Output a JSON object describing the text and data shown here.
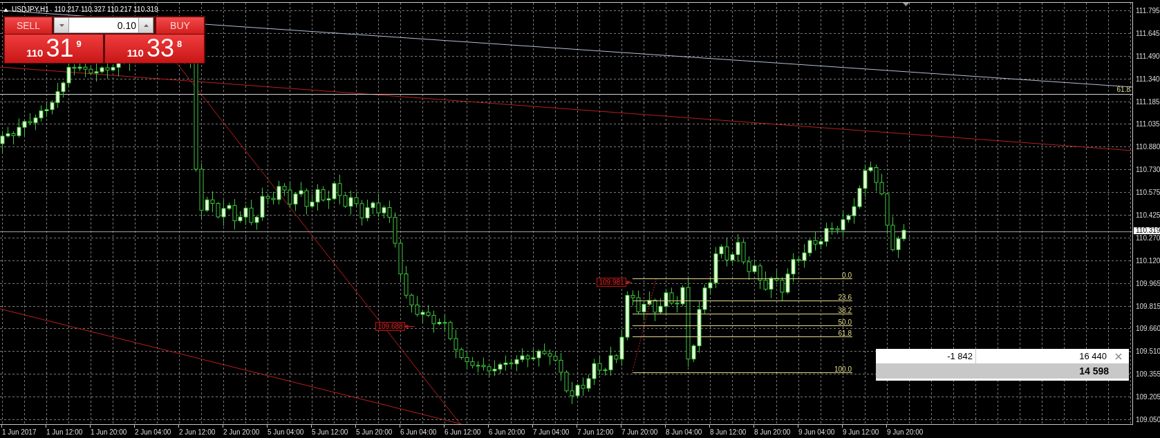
{
  "chart": {
    "symbol": "USDJPY,H1",
    "ohlc": [
      "110.217",
      "110.327",
      "110.217",
      "110.319"
    ]
  },
  "one_click_trading": {
    "sell_label": "SELL",
    "buy_label": "BUY",
    "volume": "0.10",
    "sell_quote": {
      "prefix": "110",
      "pips": "31",
      "fraction": "9"
    },
    "buy_quote": {
      "prefix": "110",
      "pips": "33",
      "fraction": "8"
    }
  },
  "horizontal_level": {
    "label": "61.8"
  },
  "fibonacci": {
    "levels": [
      "0.0",
      "23.6",
      "38.2",
      "50.0",
      "61.8",
      "100.0"
    ]
  },
  "price_labels": [
    "109.981",
    "109.688"
  ],
  "trade_summary": {
    "values": [
      "-1 842",
      "16 440"
    ],
    "total": "14 598"
  },
  "price_axis": {
    "labels": [
      "111.795",
      "111.645",
      "111.490",
      "111.340",
      "111.185",
      "111.035",
      "110.880",
      "110.730",
      "110.575",
      "110.425",
      "110.270",
      "110.120",
      "109.965",
      "109.815",
      "109.660",
      "109.510",
      "109.355",
      "109.205",
      "109.050"
    ],
    "current_price": "110.319"
  },
  "time_axis": {
    "labels": [
      "1 Jun 2017",
      "1 Jun 12:00",
      "1 Jun 20:00",
      "2 Jun 04:00",
      "2 Jun 12:00",
      "2 Jun 20:00",
      "5 Jun 04:00",
      "5 Jun 12:00",
      "5 Jun 20:00",
      "6 Jun 04:00",
      "6 Jun 12:00",
      "6 Jun 20:00",
      "7 Jun 04:00",
      "7 Jun 12:00",
      "7 Jun 20:00",
      "8 Jun 04:00",
      "8 Jun 12:00",
      "8 Jun 20:00",
      "9 Jun 04:00",
      "9 Jun 12:00",
      "9 Jun 20:00"
    ]
  }
}
